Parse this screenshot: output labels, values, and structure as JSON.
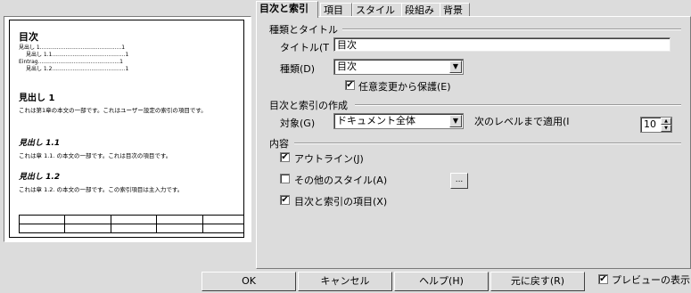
{
  "preview": {
    "toc_title": "目次",
    "toc_lines": [
      "見出し 1................................................1",
      "見出し 1.1...........................................1",
      "Eintrag................................................1",
      "見出し 1.2...........................................1"
    ],
    "h1": "見出し 1",
    "h1_text": "これは第1章の本文の一部です。これはユーザー設定の索引の項目です。",
    "h2a": "見出し 1.1",
    "h2a_text": "これは章 1.1. の本文の一部です。これは目次の項目です。",
    "h2b": "見出し 1.2",
    "h2b_text": "これは章 1.2. の本文の一部です。この索引項目は主入力です。"
  },
  "tabs": [
    {
      "label": "目次と索引"
    },
    {
      "label": "項目"
    },
    {
      "label": "スタイル"
    },
    {
      "label": "段組み"
    },
    {
      "label": "背景"
    }
  ],
  "type_title": {
    "group_label": "種類とタイトル",
    "title_label": "タイトル(T",
    "title_value": "目次",
    "type_label": "種類(D)",
    "type_value": "目次",
    "protect_label": "任意変更から保護(E)",
    "protect_checked": "✔"
  },
  "create": {
    "group_label": "目次と索引の作成",
    "scope_label": "対象(G)",
    "scope_value": "ドキュメント全体",
    "level_label": "次のレベルまで適用(I",
    "level_value": "10"
  },
  "content": {
    "group_label": "内容",
    "outline_label": "アウトライン(J)",
    "outline_checked": "✔",
    "other_styles_label": "その他のスタイル(A)",
    "other_styles_checked": "",
    "browse_label": "...",
    "index_marks_label": "目次と索引の項目(X)",
    "index_marks_checked": "✔"
  },
  "buttons": {
    "ok": "OK",
    "cancel": "キャンセル",
    "help": "ヘルプ(H)",
    "reset": "元に戻す(R)"
  },
  "preview_toggle": {
    "label": "プレビューの表示",
    "checked": "✔"
  },
  "icons": {
    "dropdown": "chevron-down-icon",
    "spin": "spin-arrows-icon"
  }
}
